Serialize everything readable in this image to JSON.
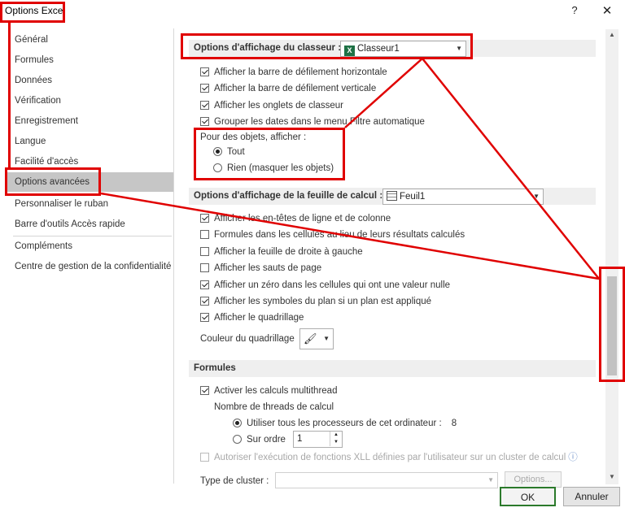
{
  "window": {
    "title": "Options Excel",
    "help_glyph": "?",
    "close_glyph": "✕"
  },
  "sidebar": {
    "items": [
      {
        "label": "Général"
      },
      {
        "label": "Formules"
      },
      {
        "label": "Données"
      },
      {
        "label": "Vérification"
      },
      {
        "label": "Enregistrement"
      },
      {
        "label": "Langue"
      },
      {
        "label": "Facilité d'accès"
      },
      {
        "label": "Options avancées",
        "selected": true
      },
      {
        "label": "Personnaliser le ruban"
      },
      {
        "label": "Barre d'outils Accès rapide"
      },
      {
        "label": "Compléments"
      },
      {
        "label": "Centre de gestion de la confidentialité"
      }
    ]
  },
  "workbook_section": {
    "header": "Options d'affichage du classeur :",
    "combo_value": "Classeur1",
    "options": [
      {
        "label": "Afficher la barre de défilement horizontale",
        "checked": true
      },
      {
        "label": "Afficher la barre de défilement verticale",
        "checked": true
      },
      {
        "label": "Afficher les onglets de classeur",
        "checked": true
      },
      {
        "label": "Grouper les dates dans le menu Filtre automatique",
        "checked": true
      }
    ],
    "objects_label": "Pour des objets, afficher :",
    "objects_options": [
      {
        "label": "Tout",
        "checked": true
      },
      {
        "label": "Rien (masquer les objets)",
        "checked": false
      }
    ]
  },
  "sheet_section": {
    "header": "Options d'affichage de la feuille de calcul :",
    "combo_value": "Feuil1",
    "options": [
      {
        "label": "Afficher les en-têtes de ligne et de colonne",
        "checked": true
      },
      {
        "label": "Formules dans les cellules au lieu de leurs résultats calculés",
        "checked": false
      },
      {
        "label": "Afficher la feuille de droite à gauche",
        "checked": false
      },
      {
        "label": "Afficher les sauts de page",
        "checked": false
      },
      {
        "label": "Afficher un zéro dans les cellules qui ont une valeur nulle",
        "checked": true
      },
      {
        "label": "Afficher les symboles du plan si un plan est appliqué",
        "checked": true
      },
      {
        "label": "Afficher le quadrillage",
        "checked": true
      }
    ],
    "grid_color_label": "Couleur du quadrillage"
  },
  "formulas_section": {
    "header": "Formules",
    "multithread_label": "Activer les calculs multithread",
    "multithread_checked": true,
    "threads_label": "Nombre de threads de calcul",
    "use_all_label": "Utiliser tous les processeurs de cet ordinateur :",
    "use_all_count": "8",
    "manual_label": "Sur ordre",
    "manual_value": "1",
    "xll_label": "Autoriser l'exécution de fonctions XLL définies par l'utilisateur sur un cluster de calcul",
    "cluster_type_label": "Type de cluster :",
    "options_button": "Options..."
  },
  "footer": {
    "ok_label": "OK",
    "cancel_label": "Annuler"
  },
  "colors": {
    "annotation_red": "#e00000",
    "excel_green": "#1e7145",
    "selected_bg": "#c6c6c6"
  }
}
